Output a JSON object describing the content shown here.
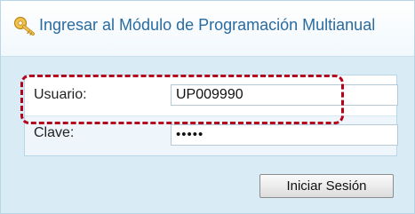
{
  "header": {
    "title": "Ingresar al Módulo de Programación Multianual",
    "icon": "key-icon"
  },
  "form": {
    "usuario_label": "Usuario:",
    "usuario_value": "UP009990",
    "clave_label": "Clave:",
    "clave_value": "•••••"
  },
  "actions": {
    "login_label": "Iniciar Sesión"
  },
  "colors": {
    "title": "#2a6ba0",
    "panel_bg": "#d9ecf5",
    "highlight": "#b3001b"
  }
}
